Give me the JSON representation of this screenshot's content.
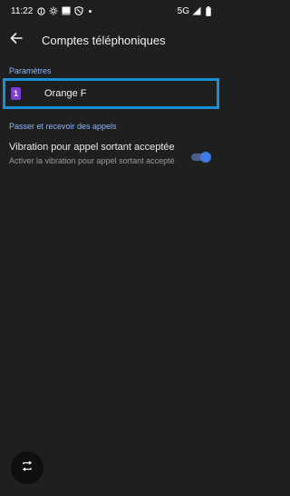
{
  "status_bar": {
    "time": "11:22",
    "network": "5G",
    "icons": [
      "info-circle-icon",
      "brightness-icon",
      "image-icon",
      "shield-icon",
      "dot-icon",
      "signal-icon",
      "battery-icon"
    ]
  },
  "app_bar": {
    "back_icon": "arrow-back-icon",
    "title": "Comptes téléphoniques"
  },
  "sections": {
    "parametres": {
      "header": "Paramètres"
    },
    "calls": {
      "header": "Passer et recevoir des appels"
    }
  },
  "account": {
    "sim_number": "1",
    "label": "Orange F",
    "sim_color": "#7a3fd1"
  },
  "vibration_setting": {
    "title": "Vibration pour appel sortant acceptée",
    "summary": "Activer la vibration pour appel sortant accepté",
    "enabled": true
  },
  "fab": {
    "icon": "rotate-screen-icon"
  },
  "colors": {
    "accent": "#8ab4f8",
    "focus_border": "#1a8fd6",
    "background": "#1f1f1f"
  }
}
